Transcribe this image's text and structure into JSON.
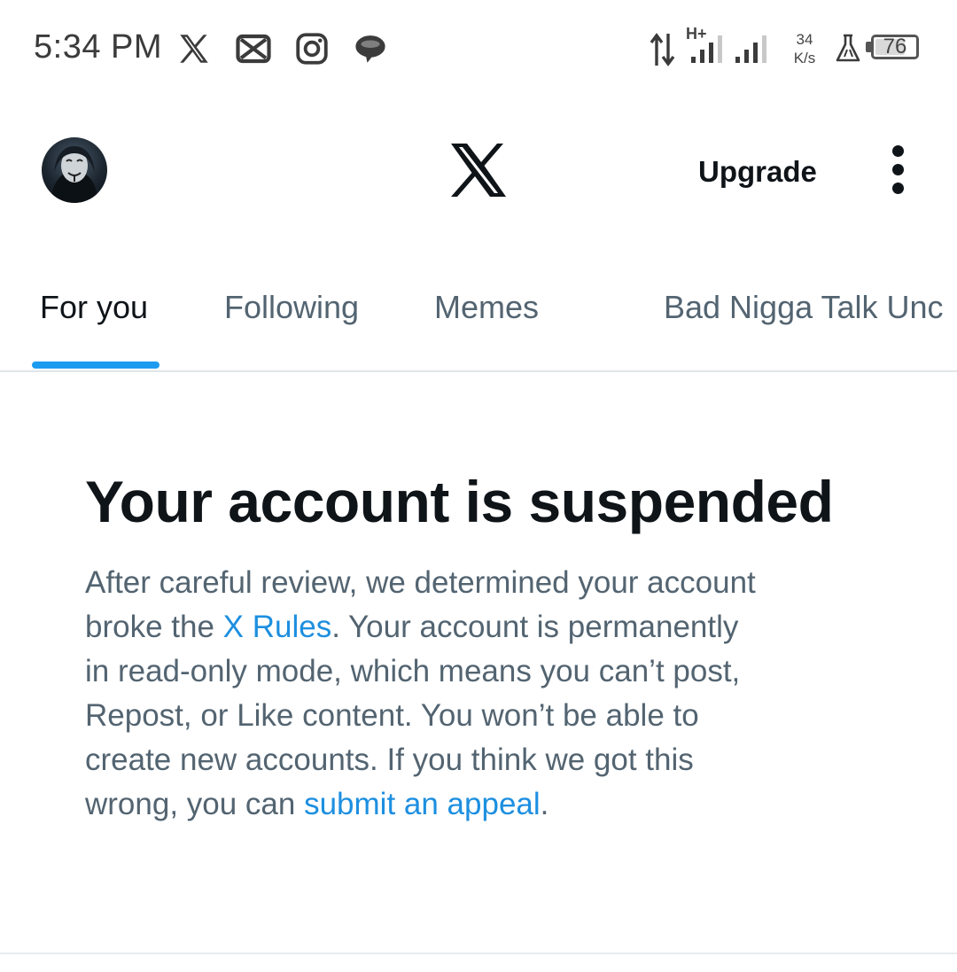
{
  "status_bar": {
    "time": "5:34 PM",
    "notification_icons": [
      "x-app-icon",
      "capcut-icon",
      "instagram-icon",
      "chat-bubble-icon"
    ],
    "network_type": "H+",
    "speed_value": "34",
    "speed_unit": "K/s",
    "battery_level": "76",
    "battery_fraction": 0.76
  },
  "header": {
    "logo": "x-logo-icon",
    "upgrade_label": "Upgrade",
    "more_icon": "vertical-dots-icon"
  },
  "tabs": [
    {
      "label": "For you",
      "active": true
    },
    {
      "label": "Following",
      "active": false
    },
    {
      "label": "Memes",
      "active": false
    },
    {
      "label": "Bad Nigga Talk Unc",
      "active": false
    }
  ],
  "notice": {
    "title": "Your account is suspended",
    "line1": "After careful review, we determined your account",
    "line2_before": "broke the ",
    "rules_link": "X Rules",
    "line2_after": ". Your account is permanently",
    "line3": "in read-only mode, which means you can’t post,",
    "line4": "Repost, or Like content. You won’t be able to",
    "line5": "create new accounts. If you think we got this",
    "line6_before": "wrong, you can ",
    "appeal_link": "submit an appeal",
    "line6_after": "."
  },
  "colors": {
    "accent": "#1d9bf0",
    "link": "#1d8fe0",
    "primary_text": "#0f1419",
    "secondary_text": "#536471"
  }
}
